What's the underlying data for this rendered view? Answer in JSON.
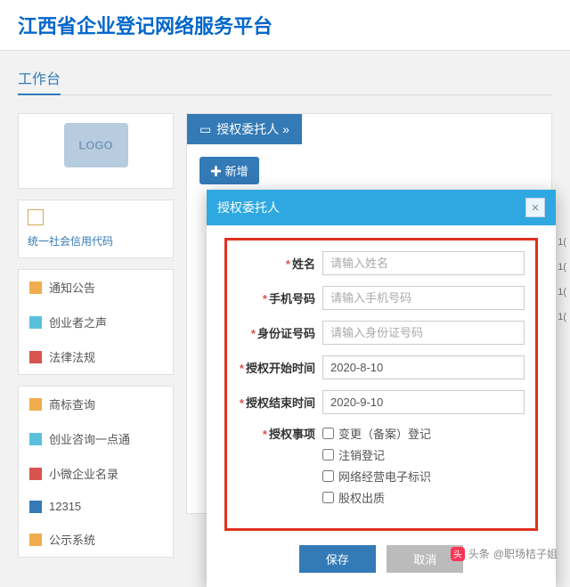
{
  "header": {
    "title": "江西省企业登记网络服务平台"
  },
  "subheader": {
    "title": "工作台"
  },
  "sidebar": {
    "credential_label": "统一社会信用代码",
    "nav1": [
      {
        "icon": "#f0ad4e",
        "label": "通知公告"
      },
      {
        "icon": "#5bc0de",
        "label": "创业者之声"
      },
      {
        "icon": "#d9534f",
        "label": "法律法规"
      }
    ],
    "nav2": [
      {
        "icon": "#f0ad4e",
        "label": "商标查询"
      },
      {
        "icon": "#5bc0de",
        "label": "创业咨询一点通"
      },
      {
        "icon": "#d9534f",
        "label": "小微企业名录"
      },
      {
        "icon": "#337ab7",
        "label": "12315"
      },
      {
        "icon": "#f0ad4e",
        "label": "公示系统"
      }
    ]
  },
  "main": {
    "panel_title": "授权委托人 »",
    "add_label": "✚ 新增"
  },
  "modal": {
    "title": "授权委托人",
    "fields": {
      "name_label": "姓名",
      "name_placeholder": "请输入姓名",
      "phone_label": "手机号码",
      "phone_placeholder": "请输入手机号码",
      "id_label": "身份证号码",
      "id_placeholder": "请输入身份证号码",
      "start_label": "授权开始时间",
      "start_value": "2020-8-10",
      "end_label": "授权结束时间",
      "end_value": "2020-9-10",
      "matters_label": "授权事项"
    },
    "matters": [
      "变更（备案）登记",
      "注销登记",
      "网络经营电子标识",
      "股权出质"
    ],
    "save": "保存",
    "cancel": "取消"
  },
  "watermark": {
    "prefix": "头条",
    "author": "@职场桔子姐"
  },
  "edge": [
    "1(",
    "1(",
    "1(",
    "1("
  ]
}
